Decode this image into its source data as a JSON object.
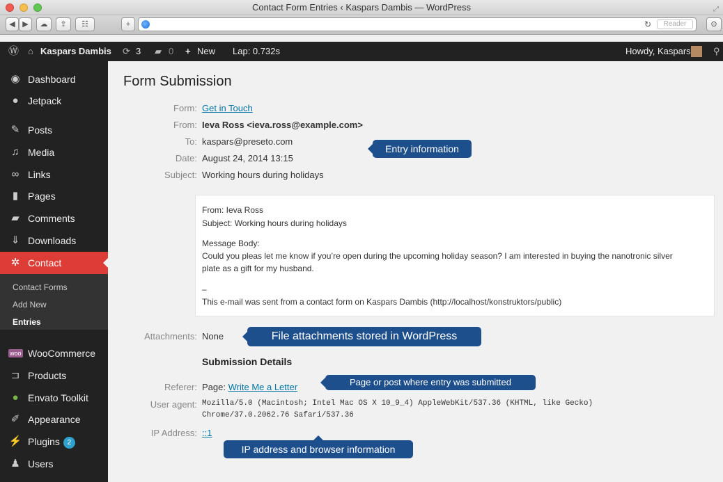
{
  "window": {
    "title": "Contact Form Entries ‹ Kaspars Dambis — WordPress"
  },
  "toolbar": {
    "reader_label": "Reader"
  },
  "adminbar": {
    "site_name": "Kaspars Dambis",
    "updates_count": "3",
    "comments_count": "0",
    "new_label": "New",
    "lap_label": "Lap: 0.732s",
    "howdy": "Howdy, Kaspars"
  },
  "sidebar": {
    "items": [
      {
        "label": "Dashboard",
        "icon": "dashboard-icon"
      },
      {
        "label": "Jetpack",
        "icon": "jetpack-icon"
      },
      {
        "label": "Posts",
        "icon": "pin-icon"
      },
      {
        "label": "Media",
        "icon": "media-icon"
      },
      {
        "label": "Links",
        "icon": "link-icon"
      },
      {
        "label": "Pages",
        "icon": "page-icon"
      },
      {
        "label": "Comments",
        "icon": "comment-icon"
      },
      {
        "label": "Downloads",
        "icon": "download-icon"
      },
      {
        "label": "Contact",
        "icon": "gear-icon"
      },
      {
        "label": "WooCommerce",
        "icon": "woo-icon"
      },
      {
        "label": "Products",
        "icon": "cart-icon"
      },
      {
        "label": "Envato Toolkit",
        "icon": "leaf-icon"
      },
      {
        "label": "Appearance",
        "icon": "brush-icon"
      },
      {
        "label": "Plugins",
        "icon": "plug-icon",
        "badge": "2"
      },
      {
        "label": "Users",
        "icon": "user-icon"
      }
    ],
    "submenu": [
      "Contact Forms",
      "Add New",
      "Entries"
    ]
  },
  "main": {
    "title": "Form Submission",
    "form_label": "Form:",
    "form_value": "Get in Touch",
    "from_label": "From:",
    "from_value": "Ieva Ross <ieva.ross@example.com>",
    "to_label": "To:",
    "to_value": "kaspars@preseto.com",
    "date_label": "Date:",
    "date_value": "August 24, 2014 13:15",
    "subject_label": "Subject:",
    "subject_value": "Working hours during holidays",
    "message": {
      "from_line": "From: Ieva Ross",
      "subject_line": "Subject: Working hours during holidays",
      "body_label": "Message Body:",
      "body_line1": "Could you pleas let me know if you’re open during the upcoming holiday season? I am interested in buying the nanotronic silver",
      "body_line2": "plate as a gift for my husband.",
      "separator": "–",
      "footer": "This e-mail was sent from a contact form on Kaspars Dambis (http://localhost/konstruktors/public)"
    },
    "attachments_label": "Attachments:",
    "attachments_value": "None",
    "details_title": "Submission Details",
    "referer_label": "Referer:",
    "referer_prefix": "Page:",
    "referer_link": "Write Me a Letter",
    "user_agent_label": "User agent:",
    "user_agent_line1": "Mozilla/5.0 (Macintosh; Intel Mac OS X 10_9_4) AppleWebKit/537.36 (KHTML, like Gecko)",
    "user_agent_line2": "Chrome/37.0.2062.76 Safari/537.36",
    "ip_label": "IP Address:",
    "ip_value": "::1"
  },
  "callouts": {
    "entry_info": "Entry information",
    "attachments": "File attachments stored in WordPress",
    "referer": "Page or post where entry was submitted",
    "ip": "IP address and browser information"
  },
  "colors": {
    "accent": "#dd3d36",
    "callout": "#1d4f8c",
    "link": "#0074a2",
    "badge": "#2ea2cc"
  }
}
